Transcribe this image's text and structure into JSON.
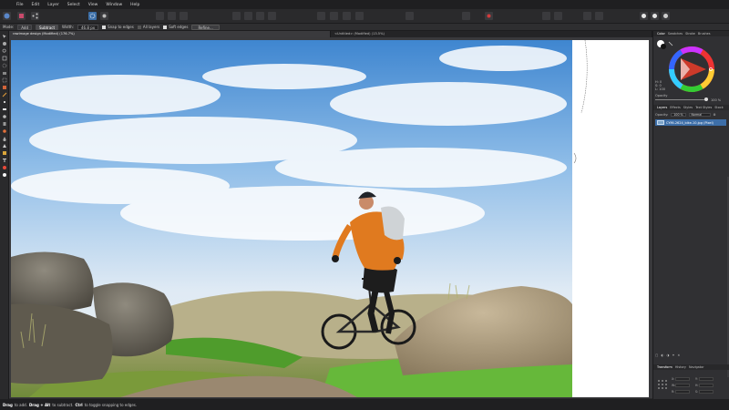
{
  "menu": [
    "File",
    "Edit",
    "Layer",
    "Select",
    "View",
    "Window",
    "Help"
  ],
  "context": {
    "mode_label": "Mode:",
    "mode_add": "Add",
    "mode_subtract": "Subtract",
    "width_label": "Width:",
    "width_value": "46.8 px",
    "snap_edges": "Snap to edges",
    "all_layers": "All layers",
    "soft_edges": "Soft edges",
    "refine": "Refine..."
  },
  "tabs": [
    "rawimage design (Modified) (176.7%)",
    "<Untitled> (Modified) (13.5%)"
  ],
  "panel_top_tabs": [
    "Color",
    "Swatches",
    "Stroke",
    "Brushes"
  ],
  "opacity_label": "Opacity",
  "opacity_value": "100 %",
  "color_values": [
    "H: 0",
    "S: 0",
    "L: 100"
  ],
  "layer_tabs": [
    "Layers",
    "Effects",
    "Styles",
    "Text Styles",
    "Stock"
  ],
  "layer_opacity_label": "Opacity:",
  "layer_opacity_value": "100 %",
  "blend_mode": "Normal",
  "layer_name": "CYMI-2624_bike-10.jpg (Pixel)",
  "transform_tabs": [
    "Transform",
    "History",
    "Navigator"
  ],
  "transform_labels": [
    "X:",
    "Y:",
    "W:",
    "H:",
    "R:",
    "S:"
  ],
  "status": {
    "drag_key": "Drag",
    "drag_text": "to add.",
    "alt_key": "Drag + Alt",
    "alt_text": "to subtract.",
    "ctrl_key": "Ctrl",
    "ctrl_text": "to toggle snapping to edges."
  },
  "colors": {
    "accent": "#3c6fa8",
    "sky": "#4a90d6",
    "jacket": "#e07a1f",
    "grass": "#5aa832"
  }
}
